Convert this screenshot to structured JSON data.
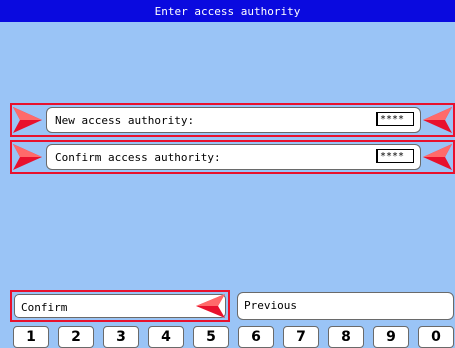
{
  "title": "Enter access authority",
  "fields": [
    {
      "label": "New access authority:",
      "value": "****"
    },
    {
      "label": "Confirm access authority:",
      "value": "****"
    }
  ],
  "buttons": {
    "confirm": "Confirm",
    "previous": "Previous"
  },
  "keypad": [
    "1",
    "2",
    "3",
    "4",
    "5",
    "6",
    "7",
    "8",
    "9",
    "0"
  ],
  "colors": {
    "titlebar": "#0a0adf",
    "background": "#9ac4f6",
    "focus": "#e8112d"
  }
}
